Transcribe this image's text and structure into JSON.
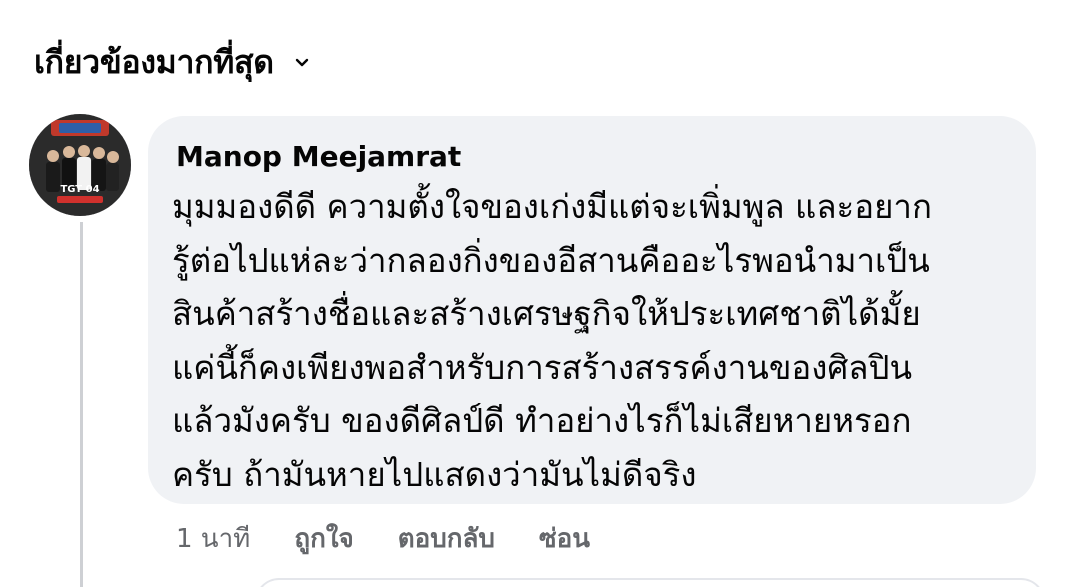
{
  "sort": {
    "label": "เกี่ยวข้องมากที่สุด",
    "icon": "chevron-down-icon"
  },
  "comment": {
    "author": "Manop Meejamrat",
    "avatar_text": "TGT 04",
    "lines": [
      "มุมมองดีดี  ความตั้งใจของเก่งมีแต่จะเพิ่มพูล และอยาก",
      "รู้ต่อไปแห่ละว่ากลองกิ่งของอีสานคืออะไรพอนำมาเป็น",
      "สินค้าสร้างชื่อและสร้างเศรษฐกิจให้ประเทศชาติได้มั้ย",
      "แค่นี้ก็คงเพียงพอสำหรับการสร้างสรรค์งานของศิลปิน",
      "แล้วมังครับ  ของดีศิลป์ดี  ทำอย่างไรก็ไม่เสียหายหรอก",
      "ครับ  ถ้ามันหายไปแสดงว่ามันไม่ดีจริง"
    ],
    "time": "1 นาที",
    "like_label": "ถูกใจ",
    "reply_label": "ตอบกลับ",
    "hide_label": "ซ่อน"
  },
  "colors": {
    "bubble_bg": "#f0f2f5",
    "secondary_text": "#65676b",
    "thread_line": "#ced0d4"
  }
}
